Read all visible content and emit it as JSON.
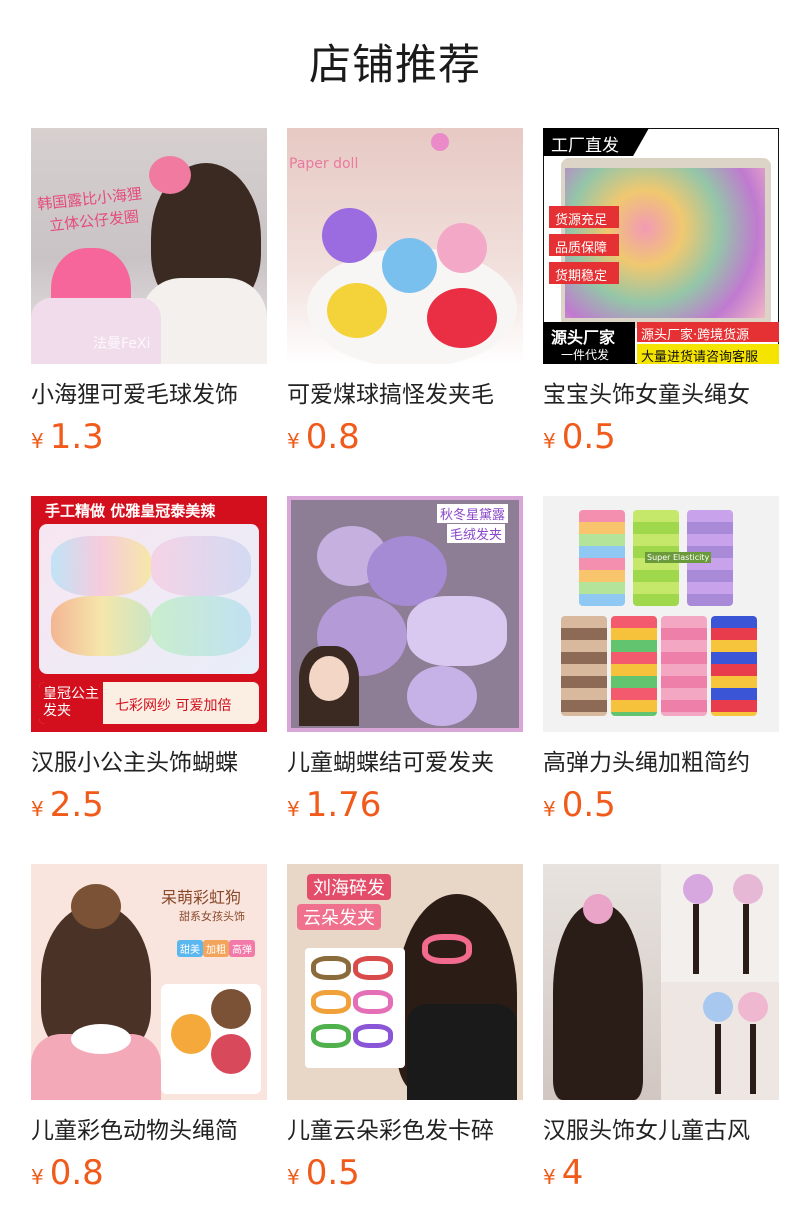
{
  "header": {
    "title": "店铺推荐"
  },
  "products": [
    {
      "name": "小海狸可爱毛球发饰",
      "currency": "¥",
      "price": "1.3",
      "image_text": [
        "韩国露比小海狸",
        "立体公仔发圈",
        "法曼FeXi"
      ]
    },
    {
      "name": "可爱煤球搞怪发夹毛",
      "currency": "¥",
      "price": "0.8",
      "image_text": [
        "Paper doll"
      ]
    },
    {
      "name": "宝宝头饰女童头绳女",
      "currency": "¥",
      "price": "0.5",
      "image_text": [
        "工厂直发",
        "货源充足",
        "品质保障",
        "货期稳定",
        "源头厂家",
        "一件代发",
        "源头厂家·跨境货源",
        "大量进货请咨询客服"
      ]
    },
    {
      "name": "汉服小公主头饰蝴蝶",
      "currency": "¥",
      "price": "2.5",
      "image_text": [
        "手工精做 优雅皇冠泰美辣",
        "皇冠公主发夹",
        "七彩网纱 可爱加倍"
      ]
    },
    {
      "name": "儿童蝴蝶结可爱发夹",
      "currency": "¥",
      "price": "1.76",
      "image_text": [
        "秋冬星黛露",
        "毛绒发夹"
      ]
    },
    {
      "name": "高弹力头绳加粗简约",
      "currency": "¥",
      "price": "0.5",
      "image_text": [
        "Super Elasticity"
      ]
    },
    {
      "name": "儿童彩色动物头绳简",
      "currency": "¥",
      "price": "0.8",
      "image_text": [
        "呆萌彩虹狗",
        "甜系女孩头饰",
        "甜美",
        "加粗",
        "高弹"
      ]
    },
    {
      "name": "儿童云朵彩色发卡碎",
      "currency": "¥",
      "price": "0.5",
      "image_text": [
        "刘海碎发",
        "云朵发夹"
      ]
    },
    {
      "name": "汉服头饰女儿童古风",
      "currency": "¥",
      "price": "4",
      "image_text": []
    }
  ],
  "colors": {
    "price": "#f05a1a",
    "title": "#1a1a1a",
    "name": "#222222"
  }
}
